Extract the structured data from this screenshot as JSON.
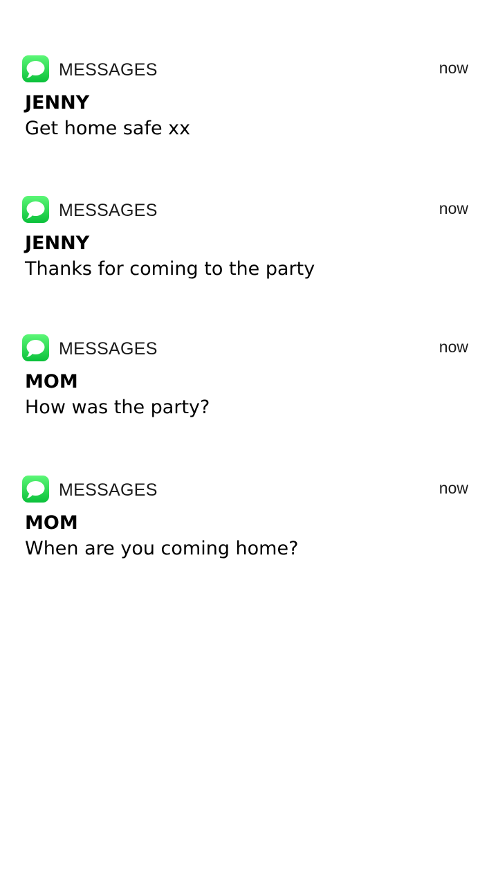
{
  "notifications": [
    {
      "app_name": "MESSAGES",
      "app_icon": "messages-icon",
      "time": "now",
      "sender": "JENNY",
      "message": "Get home safe xx"
    },
    {
      "app_name": "MESSAGES",
      "app_icon": "messages-icon",
      "time": "now",
      "sender": "JENNY",
      "message": "Thanks for coming to the party"
    },
    {
      "app_name": "MESSAGES",
      "app_icon": "messages-icon",
      "time": "now",
      "sender": "MOM",
      "message": "How was the party?"
    },
    {
      "app_name": "MESSAGES",
      "app_icon": "messages-icon",
      "time": "now",
      "sender": "MOM",
      "message": "When are you coming home?"
    }
  ],
  "colors": {
    "icon_top": "#5cf777",
    "icon_bottom": "#0ac03a",
    "text": "#000000",
    "background": "#ffffff"
  }
}
